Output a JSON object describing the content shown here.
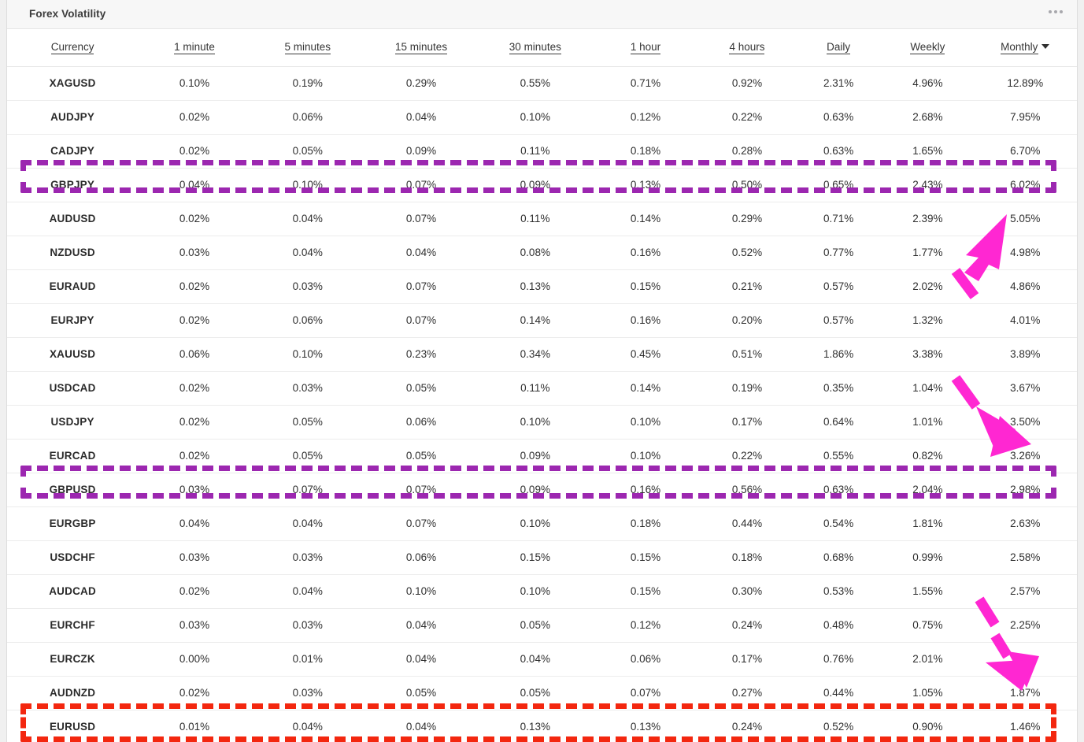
{
  "panel": {
    "title": "Forex Volatility",
    "menu_icon": "kebab-menu-icon"
  },
  "table": {
    "columns": [
      "Currency",
      "1 minute",
      "5 minutes",
      "15 minutes",
      "30 minutes",
      "1 hour",
      "4 hours",
      "Daily",
      "Weekly",
      "Monthly"
    ],
    "sorted_column": "Monthly",
    "sort_direction": "descending",
    "rows": [
      {
        "currency": "XAGUSD",
        "m1": "0.10%",
        "m5": "0.19%",
        "m15": "0.29%",
        "m30": "0.55%",
        "h1": "0.71%",
        "h4": "0.92%",
        "daily": "2.31%",
        "weekly": "4.96%",
        "monthly": "12.89%"
      },
      {
        "currency": "AUDJPY",
        "m1": "0.02%",
        "m5": "0.06%",
        "m15": "0.04%",
        "m30": "0.10%",
        "h1": "0.12%",
        "h4": "0.22%",
        "daily": "0.63%",
        "weekly": "2.68%",
        "monthly": "7.95%"
      },
      {
        "currency": "CADJPY",
        "m1": "0.02%",
        "m5": "0.05%",
        "m15": "0.09%",
        "m30": "0.11%",
        "h1": "0.18%",
        "h4": "0.28%",
        "daily": "0.63%",
        "weekly": "1.65%",
        "monthly": "6.70%"
      },
      {
        "currency": "GBPJPY",
        "m1": "0.04%",
        "m5": "0.10%",
        "m15": "0.07%",
        "m30": "0.09%",
        "h1": "0.13%",
        "h4": "0.50%",
        "daily": "0.65%",
        "weekly": "2.43%",
        "monthly": "6.02%"
      },
      {
        "currency": "AUDUSD",
        "m1": "0.02%",
        "m5": "0.04%",
        "m15": "0.07%",
        "m30": "0.11%",
        "h1": "0.14%",
        "h4": "0.29%",
        "daily": "0.71%",
        "weekly": "2.39%",
        "monthly": "5.05%"
      },
      {
        "currency": "NZDUSD",
        "m1": "0.03%",
        "m5": "0.04%",
        "m15": "0.04%",
        "m30": "0.08%",
        "h1": "0.16%",
        "h4": "0.52%",
        "daily": "0.77%",
        "weekly": "1.77%",
        "monthly": "4.98%"
      },
      {
        "currency": "EURAUD",
        "m1": "0.02%",
        "m5": "0.03%",
        "m15": "0.07%",
        "m30": "0.13%",
        "h1": "0.15%",
        "h4": "0.21%",
        "daily": "0.57%",
        "weekly": "2.02%",
        "monthly": "4.86%"
      },
      {
        "currency": "EURJPY",
        "m1": "0.02%",
        "m5": "0.06%",
        "m15": "0.07%",
        "m30": "0.14%",
        "h1": "0.16%",
        "h4": "0.20%",
        "daily": "0.57%",
        "weekly": "1.32%",
        "monthly": "4.01%"
      },
      {
        "currency": "XAUUSD",
        "m1": "0.06%",
        "m5": "0.10%",
        "m15": "0.23%",
        "m30": "0.34%",
        "h1": "0.45%",
        "h4": "0.51%",
        "daily": "1.86%",
        "weekly": "3.38%",
        "monthly": "3.89%"
      },
      {
        "currency": "USDCAD",
        "m1": "0.02%",
        "m5": "0.03%",
        "m15": "0.05%",
        "m30": "0.11%",
        "h1": "0.14%",
        "h4": "0.19%",
        "daily": "0.35%",
        "weekly": "1.04%",
        "monthly": "3.67%"
      },
      {
        "currency": "USDJPY",
        "m1": "0.02%",
        "m5": "0.05%",
        "m15": "0.06%",
        "m30": "0.10%",
        "h1": "0.10%",
        "h4": "0.17%",
        "daily": "0.64%",
        "weekly": "1.01%",
        "monthly": "3.50%"
      },
      {
        "currency": "EURCAD",
        "m1": "0.02%",
        "m5": "0.05%",
        "m15": "0.05%",
        "m30": "0.09%",
        "h1": "0.10%",
        "h4": "0.22%",
        "daily": "0.55%",
        "weekly": "0.82%",
        "monthly": "3.26%"
      },
      {
        "currency": "GBPUSD",
        "m1": "0.03%",
        "m5": "0.07%",
        "m15": "0.07%",
        "m30": "0.09%",
        "h1": "0.16%",
        "h4": "0.56%",
        "daily": "0.63%",
        "weekly": "2.04%",
        "monthly": "2.98%"
      },
      {
        "currency": "EURGBP",
        "m1": "0.04%",
        "m5": "0.04%",
        "m15": "0.07%",
        "m30": "0.10%",
        "h1": "0.18%",
        "h4": "0.44%",
        "daily": "0.54%",
        "weekly": "1.81%",
        "monthly": "2.63%"
      },
      {
        "currency": "USDCHF",
        "m1": "0.03%",
        "m5": "0.03%",
        "m15": "0.06%",
        "m30": "0.15%",
        "h1": "0.15%",
        "h4": "0.18%",
        "daily": "0.68%",
        "weekly": "0.99%",
        "monthly": "2.58%"
      },
      {
        "currency": "AUDCAD",
        "m1": "0.02%",
        "m5": "0.04%",
        "m15": "0.10%",
        "m30": "0.10%",
        "h1": "0.15%",
        "h4": "0.30%",
        "daily": "0.53%",
        "weekly": "1.55%",
        "monthly": "2.57%"
      },
      {
        "currency": "EURCHF",
        "m1": "0.03%",
        "m5": "0.03%",
        "m15": "0.04%",
        "m30": "0.05%",
        "h1": "0.12%",
        "h4": "0.24%",
        "daily": "0.48%",
        "weekly": "0.75%",
        "monthly": "2.25%"
      },
      {
        "currency": "EURCZK",
        "m1": "0.00%",
        "m5": "0.01%",
        "m15": "0.04%",
        "m30": "0.04%",
        "h1": "0.06%",
        "h4": "0.17%",
        "daily": "0.76%",
        "weekly": "2.01%",
        "monthly": ""
      },
      {
        "currency": "AUDNZD",
        "m1": "0.02%",
        "m5": "0.03%",
        "m15": "0.05%",
        "m30": "0.05%",
        "h1": "0.07%",
        "h4": "0.27%",
        "daily": "0.44%",
        "weekly": "1.05%",
        "monthly": "1.87%"
      },
      {
        "currency": "EURUSD",
        "m1": "0.01%",
        "m5": "0.04%",
        "m15": "0.04%",
        "m30": "0.13%",
        "h1": "0.13%",
        "h4": "0.24%",
        "daily": "0.52%",
        "weekly": "0.90%",
        "monthly": "1.46%"
      }
    ]
  },
  "annotations": {
    "purple_color": "#9c27b0",
    "red_color": "#f3270f",
    "cursor_color": "#ff27d2",
    "boxes": [
      {
        "name": "highlight-gbpjpy-row",
        "color": "#9c27b0"
      },
      {
        "name": "highlight-gbpusd-row",
        "color": "#9c27b0"
      },
      {
        "name": "highlight-eurusd-row",
        "color": "#f3270f"
      }
    ],
    "cursors": [
      {
        "name": "cursor-pointer-audusd-monthly"
      },
      {
        "name": "cursor-arrow-eurcad-monthly"
      },
      {
        "name": "cursor-arrow-eurczk-monthly"
      }
    ]
  }
}
